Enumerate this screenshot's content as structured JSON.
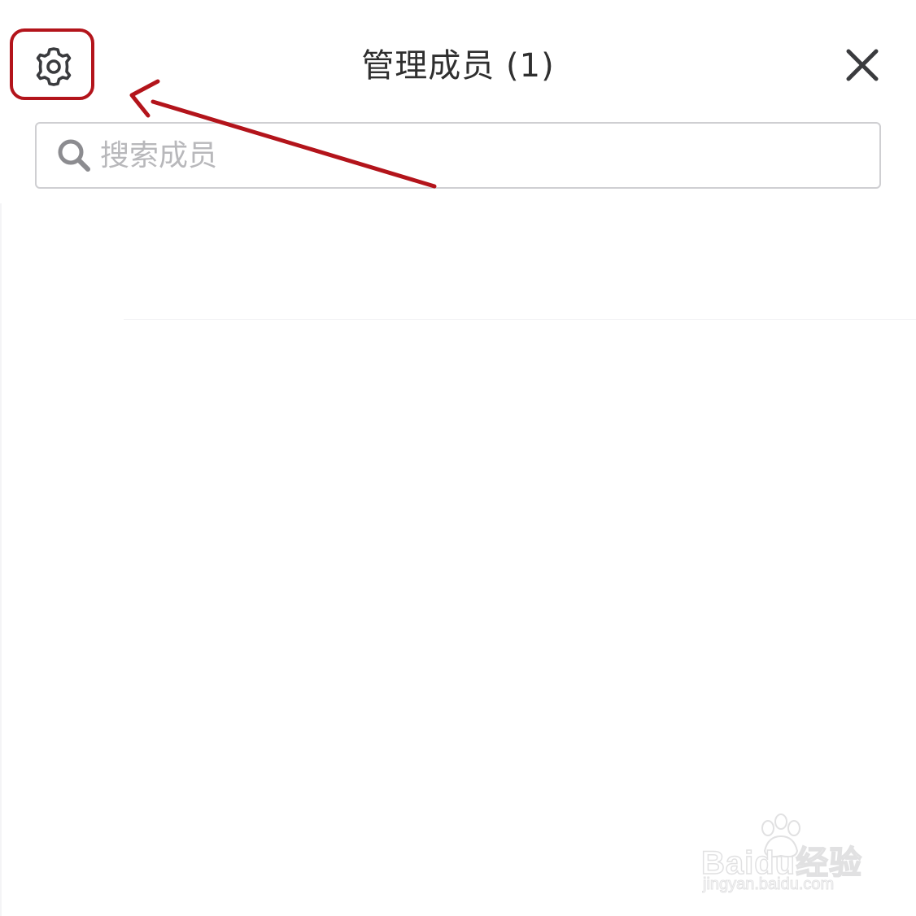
{
  "header": {
    "title": "管理成员 (1)",
    "settings_icon": "gear-icon",
    "close_icon": "close-icon"
  },
  "search": {
    "placeholder": "搜索成员",
    "value": "",
    "icon": "search-icon"
  },
  "annotation": {
    "color": "#b3141b"
  },
  "watermark": {
    "brand": "Baidu经验",
    "url": "jingyan.baidu.com"
  }
}
